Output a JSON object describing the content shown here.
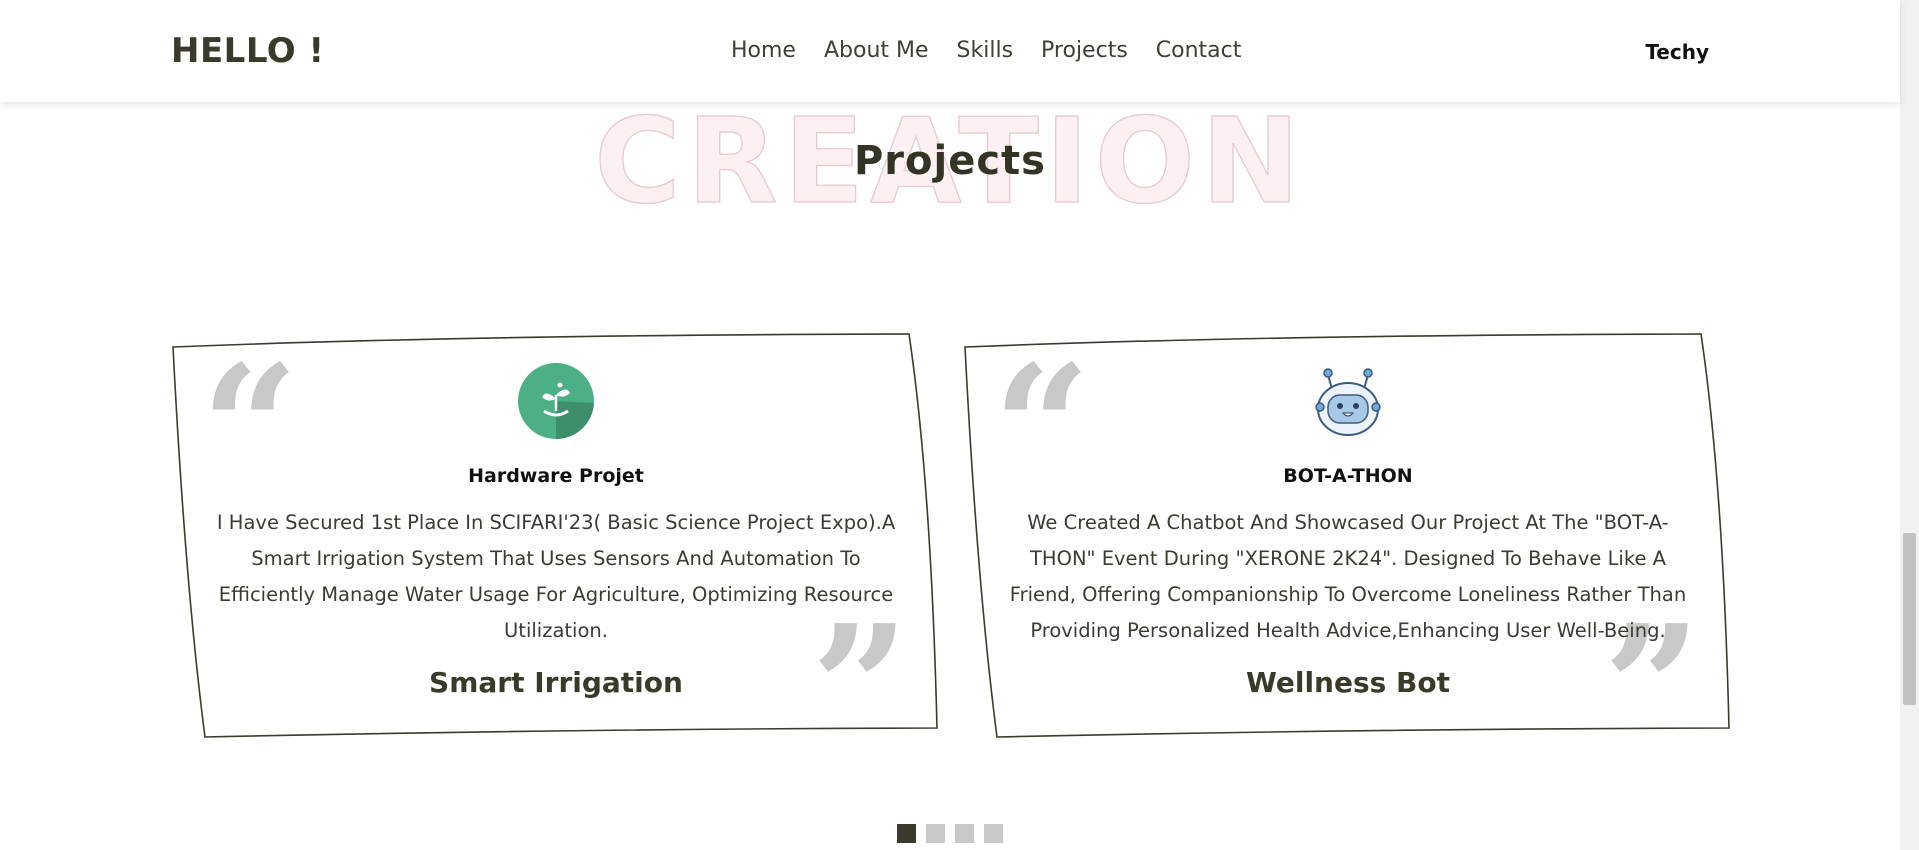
{
  "header": {
    "logo": "HELLO !",
    "nav": [
      "Home",
      "About Me",
      "Skills",
      "Projects",
      "Contact"
    ],
    "right_label": "Techy"
  },
  "section": {
    "background_word": "CREATION",
    "title": "Projects"
  },
  "cards": [
    {
      "kind": "Hardware Projet",
      "description": "I Have Secured 1st Place In SCIFARI'23( Basic Science Project Expo).A Smart Irrigation System That Uses Sensors And Automation To Efficiently Manage Water Usage For Agriculture, Optimizing Resource Utilization.",
      "title": "Smart Irrigation",
      "icon": "plant-logo-icon"
    },
    {
      "kind": "BOT-A-THON",
      "description": "We Created A Chatbot And Showcased Our Project At The \"BOT-A-THON\" Event During \"XERONE 2K24\". Designed To Behave Like A Friend, Offering Companionship To Overcome Loneliness Rather Than Providing Personalized Health Advice,Enhancing User Well-Being.",
      "title": "Wellness Bot",
      "icon": "robot-icon"
    }
  ],
  "pagination": {
    "pages": 4,
    "active": 1
  },
  "colors": {
    "accent": "#3b3b2c",
    "quote": "#c8c8c8",
    "plant_bg": "#4caf85"
  }
}
